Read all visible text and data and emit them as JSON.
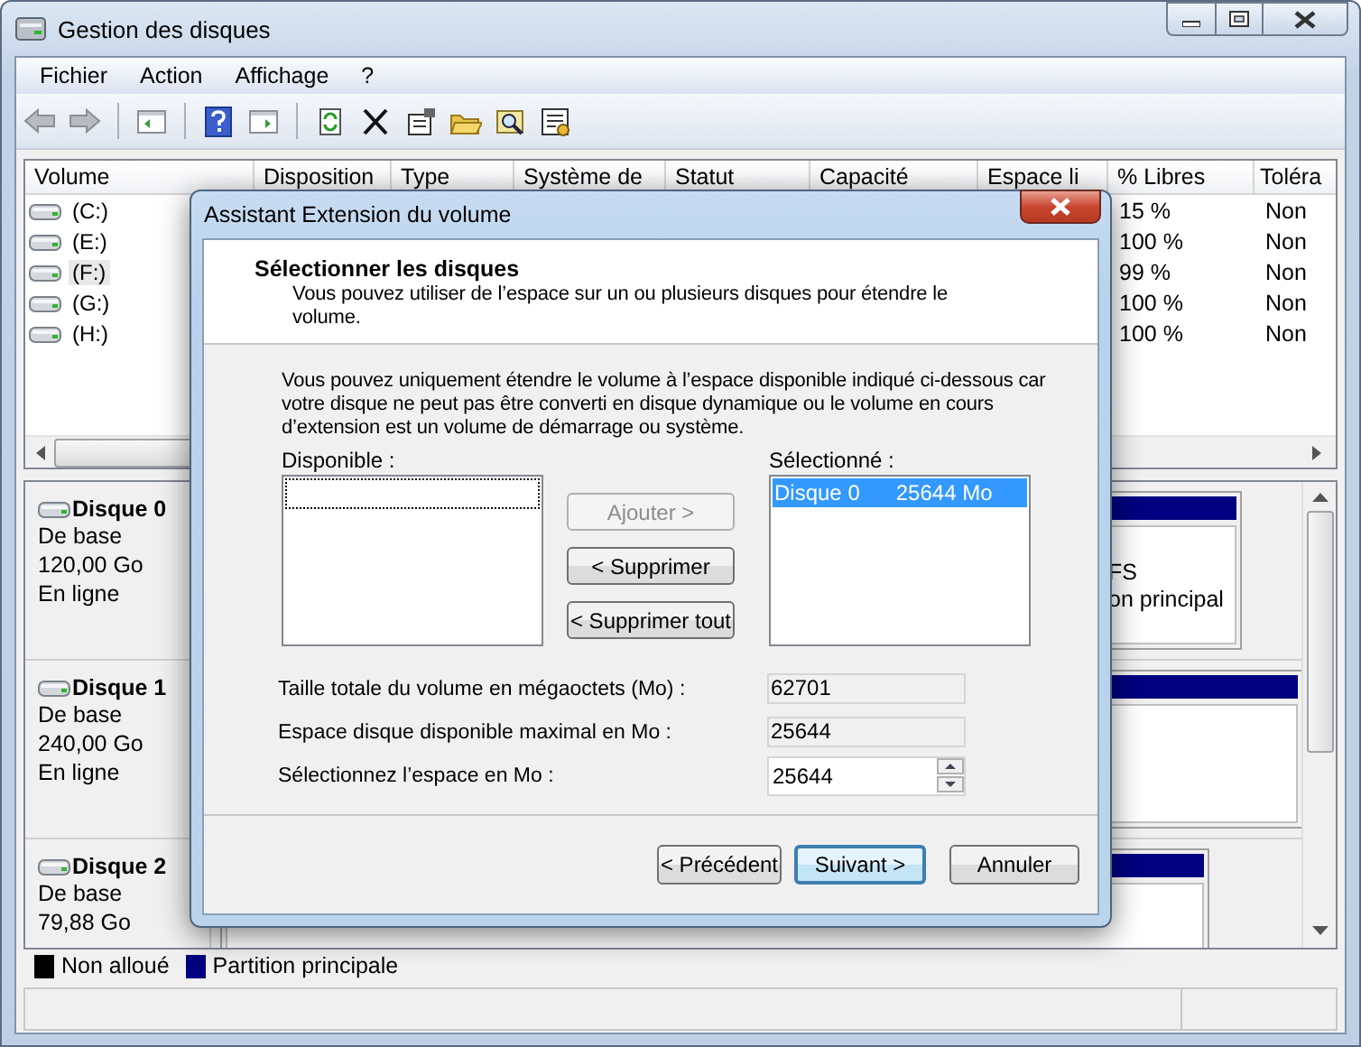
{
  "window": {
    "title": "Gestion des disques"
  },
  "menu": [
    "Fichier",
    "Action",
    "Affichage",
    "?"
  ],
  "volume_table": {
    "columns": [
      "Volume",
      "Disposition",
      "Type",
      "Système de",
      "Statut",
      "Capacité",
      "Espace li",
      "% Libres",
      "Toléra"
    ],
    "rows": [
      {
        "volume": "(C:)",
        "percent_free": "15 %",
        "fault_tolerance": "Non",
        "selected": false
      },
      {
        "volume": "(E:)",
        "percent_free": "100 %",
        "fault_tolerance": "Non",
        "selected": false
      },
      {
        "volume": "(F:)",
        "percent_free": "99 %",
        "fault_tolerance": "Non",
        "selected": true
      },
      {
        "volume": "(G:)",
        "percent_free": "100 %",
        "fault_tolerance": "Non",
        "selected": false
      },
      {
        "volume": "(H:)",
        "percent_free": "100 %",
        "fault_tolerance": "Non",
        "selected": false
      }
    ]
  },
  "disks": [
    {
      "name": "Disque 0",
      "type": "De base",
      "size": "120,00 Go",
      "status": "En ligne",
      "partition_texts": [
        "FS",
        "on principal"
      ]
    },
    {
      "name": "Disque 1",
      "type": "De base",
      "size": "240,00 Go",
      "status": "En ligne"
    },
    {
      "name": "Disque 2",
      "type": "De base",
      "size": "79,88 Go"
    }
  ],
  "legend": [
    {
      "label": "Non alloué",
      "color": "#000000"
    },
    {
      "label": "Partition principale",
      "color": "#000080"
    }
  ],
  "dialog": {
    "title": "Assistant Extension du volume",
    "heading": "Sélectionner les disques",
    "subtitle": "Vous pouvez utiliser de l’espace sur un ou plusieurs disques pour étendre le volume.",
    "notice": "Vous pouvez uniquement étendre le volume à l’espace disponible indiqué ci-dessous car votre disque ne peut pas être converti en disque dynamique ou le volume en cours d’extension est un volume de démarrage ou système.",
    "available_label": "Disponible :",
    "selected_label": "Sélectionné :",
    "selected_list": [
      {
        "disk": "Disque 0",
        "size": "25644 Mo",
        "selected": true
      }
    ],
    "middle_buttons": [
      {
        "label": "Ajouter >",
        "disabled": true
      },
      {
        "label": "< Supprimer",
        "disabled": false
      },
      {
        "label": "< Supprimer tout",
        "disabled": false
      }
    ],
    "fields": [
      {
        "kind": "readonly",
        "label": "Taille totale du volume en mégaoctets (Mo) :",
        "value": "62701"
      },
      {
        "kind": "readonly",
        "label": "Espace disque disponible maximal en Mo :",
        "value": "25644"
      },
      {
        "kind": "spin",
        "label": "Sélectionnez l’espace en Mo :",
        "value": "25644"
      }
    ],
    "footer_buttons": [
      {
        "label": "< Précédent",
        "default": false
      },
      {
        "label": "Suivant >",
        "default": true
      },
      {
        "label": "Annuler",
        "default": false
      }
    ]
  }
}
